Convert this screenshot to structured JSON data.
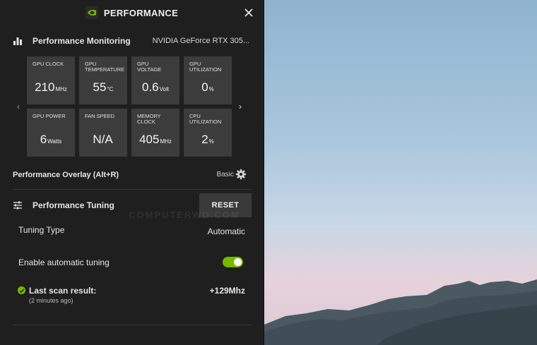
{
  "window": {
    "title": "PERFORMANCE"
  },
  "monitoring": {
    "label": "Performance Monitoring",
    "gpu_name": "NVIDIA GeForce RTX 305...",
    "tiles": [
      {
        "label": "GPU CLOCK",
        "value": "210",
        "unit": "MHz"
      },
      {
        "label": "GPU TEMPERATURE",
        "value": "55",
        "unit": "°C"
      },
      {
        "label": "GPU VOLTAGE",
        "value": "0.6",
        "unit": "Volt"
      },
      {
        "label": "GPU UTILIZATION",
        "value": "0",
        "unit": "%"
      },
      {
        "label": "GPU POWER",
        "value": "6",
        "unit": "Watts"
      },
      {
        "label": "FAN SPEED",
        "value": "N/A",
        "unit": ""
      },
      {
        "label": "MEMORY CLOCK",
        "value": "405",
        "unit": "MHz"
      },
      {
        "label": "CPU UTILIZATION",
        "value": "2",
        "unit": "%"
      }
    ]
  },
  "overlay": {
    "label": "Performance Overlay (Alt+R)",
    "mode": "Basic"
  },
  "tuning": {
    "label": "Performance Tuning",
    "reset_label": "RESET",
    "type_label": "Tuning Type",
    "type_value": "Automatic",
    "auto_label": "Enable automatic tuning",
    "auto_enabled": true,
    "scan_label": "Last scan result:",
    "scan_time": "(2 minutes ago)",
    "scan_value": "+129Mhz"
  },
  "watermark": "COMPUTERWD.COM",
  "colors": {
    "accent": "#76b900",
    "panel": "#1f1f1f",
    "tile": "#3c3c3c"
  }
}
